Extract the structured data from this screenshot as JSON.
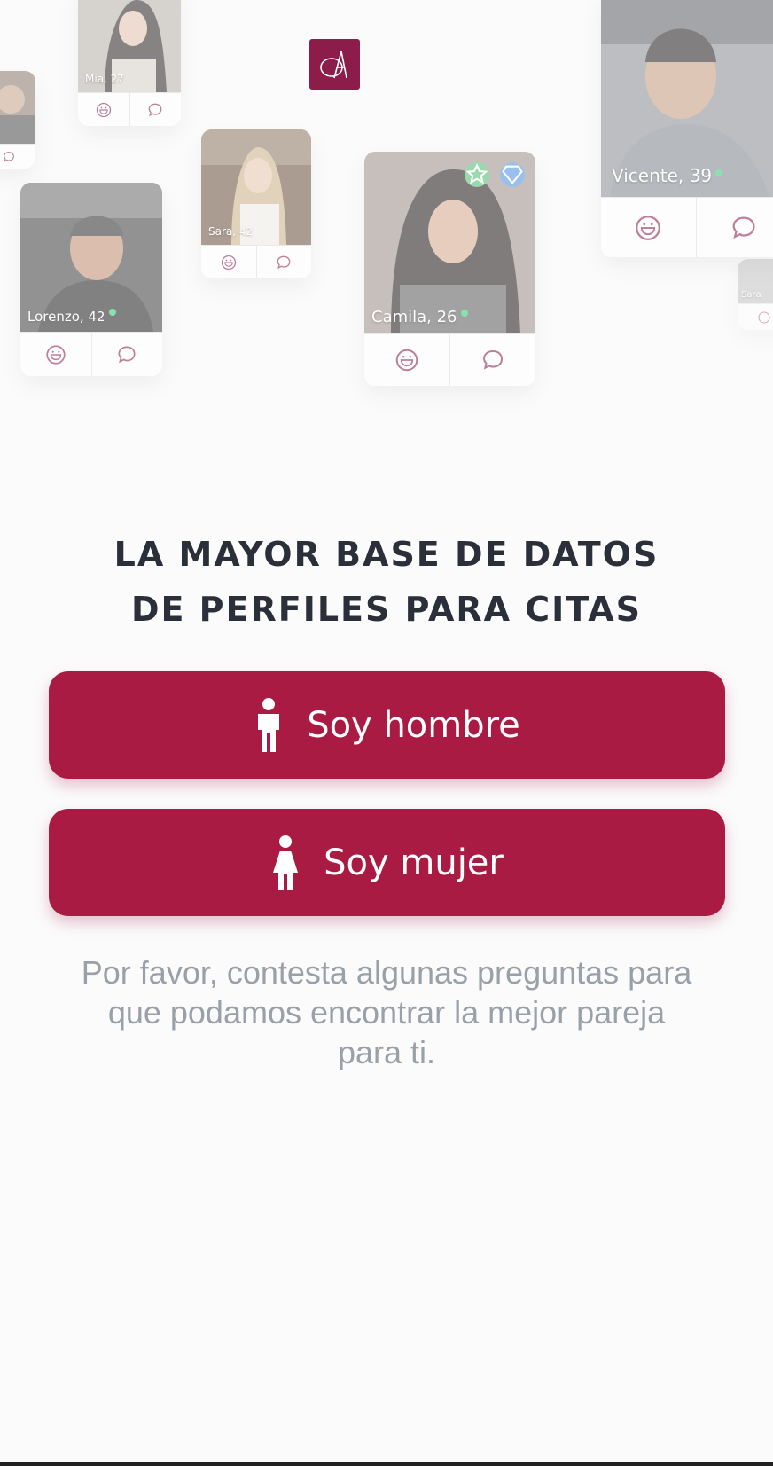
{
  "hero": {
    "logo_alt": "logo-mark",
    "profiles": [
      {
        "name": "Mia, 27"
      },
      {
        "name": "Sara, 42"
      },
      {
        "name": "Lorenzo, 42"
      },
      {
        "name": "Camila, 26"
      },
      {
        "name": "Vicente, 39"
      },
      {
        "name": "Sara"
      }
    ]
  },
  "headline": {
    "line1": "LA MAYOR BASE DE DATOS",
    "line2": "DE PERFILES PARA CITAS"
  },
  "buttons": {
    "man_label": "Soy hombre",
    "woman_label": "Soy mujer"
  },
  "info_text": "Por favor, contesta algunas preguntas para que podamos encontrar la mejor pareja para ti.",
  "colors": {
    "accent": "#a91b43",
    "logo_bg": "#8c1d4a",
    "headline": "#2a2f3a",
    "muted_text": "#9aa0a8",
    "online": "#2ecc71"
  }
}
